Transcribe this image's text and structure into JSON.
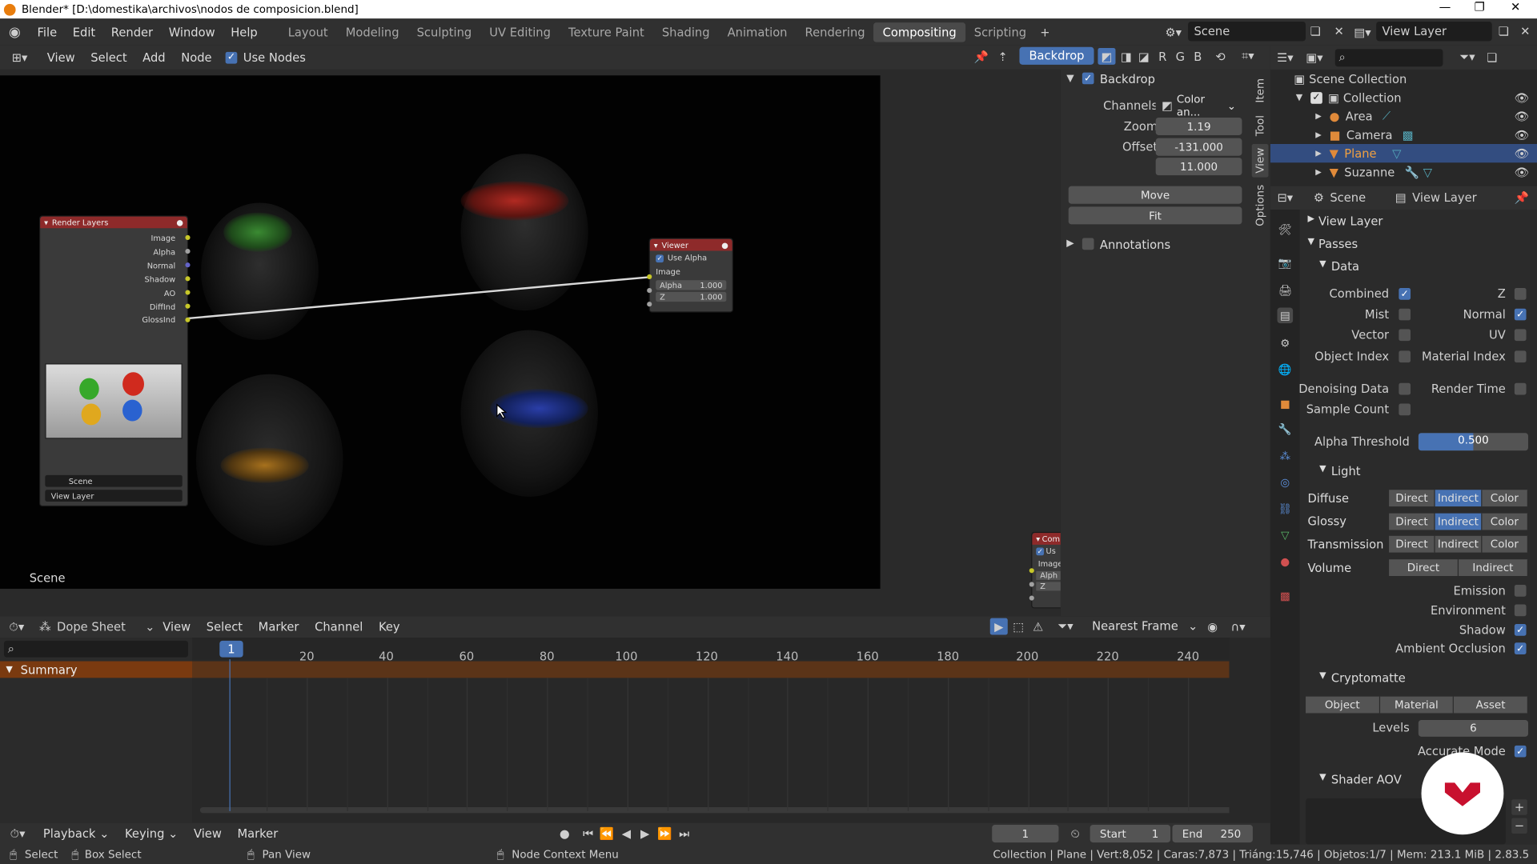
{
  "window": {
    "title": "Blender* [D:\\domestika\\archivos\\nodos de composicion.blend]"
  },
  "menus": [
    "File",
    "Edit",
    "Render",
    "Window",
    "Help"
  ],
  "workspaces": [
    "Layout",
    "Modeling",
    "Sculpting",
    "UV Editing",
    "Texture Paint",
    "Shading",
    "Animation",
    "Rendering",
    "Compositing",
    "Scripting"
  ],
  "active_workspace": "Compositing",
  "scene_name": "Scene",
  "view_layer_name": "View Layer",
  "node_header": {
    "view": "View",
    "select": "Select",
    "add": "Add",
    "node": "Node",
    "use_nodes": "Use Nodes",
    "backdrop_btn": "Backdrop",
    "channels": [
      "R",
      "G",
      "B"
    ]
  },
  "canvas_scene_label": "Scene",
  "render_layers_node": {
    "title": "Render Layers",
    "outputs": [
      "Image",
      "Alpha",
      "Normal",
      "Shadow",
      "AO",
      "DiffInd",
      "GlossInd"
    ],
    "scene": "Scene",
    "view_layer": "View Layer"
  },
  "viewer_node": {
    "title": "Viewer",
    "use_alpha": "Use Alpha",
    "image": "Image",
    "alpha_label": "Alpha",
    "alpha_value": "1.000",
    "z_label": "Z",
    "z_value": "1.000"
  },
  "composite_node": {
    "title": "Com",
    "use": "Us",
    "image": "Image",
    "alpha": "Alph",
    "z": "Z"
  },
  "sidebar": {
    "backdrop_title": "Backdrop",
    "channels_label": "Channels",
    "channels_value": "Color an...",
    "zoom_label": "Zoom",
    "zoom_value": "1.19",
    "offset_label": "Offset",
    "offset_x": "-131.000",
    "offset_y": "11.000",
    "move": "Move",
    "fit": "Fit",
    "annotations": "Annotations",
    "tabs": [
      "Item",
      "Tool",
      "View",
      "Options"
    ]
  },
  "outliner": {
    "scene_collection": "Scene Collection",
    "items": [
      {
        "name": "Collection",
        "indent": 0
      },
      {
        "name": "Area",
        "indent": 1
      },
      {
        "name": "Camera",
        "indent": 1
      },
      {
        "name": "Plane",
        "indent": 1,
        "selected": true
      },
      {
        "name": "Suzanne",
        "indent": 1
      }
    ]
  },
  "properties": {
    "scene": "Scene",
    "view_layer": "View Layer",
    "view_layer_section": "View Layer",
    "passes": "Passes",
    "data": "Data",
    "combined": "Combined",
    "z": "Z",
    "mist": "Mist",
    "normal": "Normal",
    "vector": "Vector",
    "uv": "UV",
    "object_index": "Object Index",
    "material_index": "Material Index",
    "denoising_data": "Denoising Data",
    "render_time": "Render Time",
    "sample_count": "Sample Count",
    "alpha_threshold_label": "Alpha Threshold",
    "alpha_threshold": "0.500",
    "alpha_threshold_fill": 0.5,
    "light": "Light",
    "diffuse": "Diffuse",
    "glossy": "Glossy",
    "transmission": "Transmission",
    "volume": "Volume",
    "direct": "Direct",
    "indirect": "Indirect",
    "color": "Color",
    "emission": "Emission",
    "environment": "Environment",
    "shadow": "Shadow",
    "ambient_occlusion": "Ambient Occlusion",
    "cryptomatte": "Cryptomatte",
    "object": "Object",
    "material": "Material",
    "asset": "Asset",
    "levels_label": "Levels",
    "levels": "6",
    "accurate_mode": "Accurate Mode",
    "shader_aov": "Shader AOV"
  },
  "dope_sheet": {
    "mode": "Dope Sheet",
    "view": "View",
    "select": "Select",
    "marker": "Marker",
    "channel": "Channel",
    "key": "Key",
    "snap": "Nearest Frame",
    "summary": "Summary",
    "current_frame": "1",
    "ticks": [
      "20",
      "40",
      "60",
      "80",
      "100",
      "120",
      "140",
      "160",
      "180",
      "200",
      "220",
      "240"
    ]
  },
  "timeline_footer": {
    "playback": "Playback",
    "keying": "Keying",
    "view": "View",
    "marker": "Marker",
    "frame": "1",
    "start_label": "Start",
    "start": "1",
    "end_label": "End",
    "end": "250"
  },
  "statusbar": {
    "select": "Select",
    "box_select": "Box Select",
    "pan_view": "Pan View",
    "node_context_menu": "Node Context Menu",
    "info": "Collection | Plane | Vert:8,052 | Caras:7,873 | Triáng:15,746 | Objetos:1/7 | Mem: 213.1 MiB | 2.83.5"
  },
  "colors": {
    "accent": "#4772b3",
    "active_tab": "#4a4a4a",
    "node_header": "#8e2a2a",
    "summary_row": "#7a3a10",
    "watermark": "#c8102e"
  }
}
